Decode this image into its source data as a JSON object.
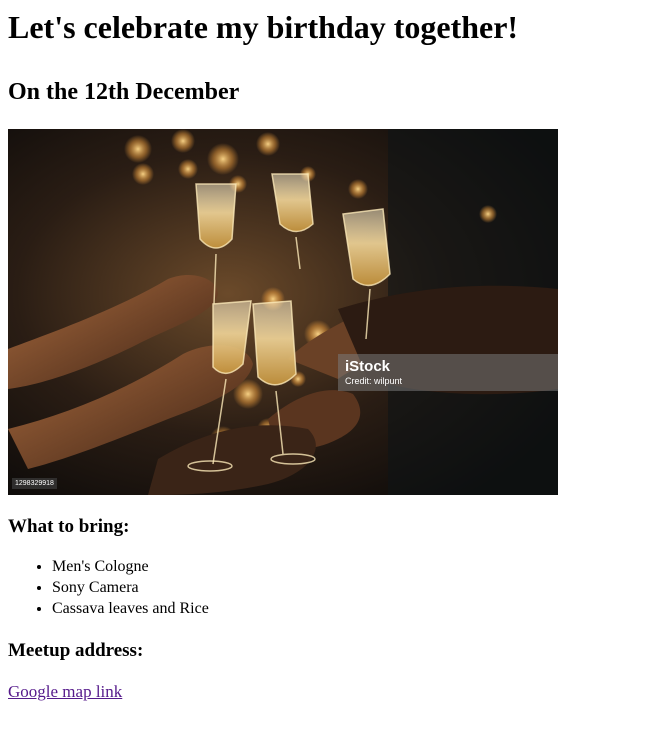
{
  "page": {
    "title": "Let's celebrate my birthday together!",
    "date_heading": "On the 12th December"
  },
  "photo": {
    "description_icon": "champagne-toast-photo",
    "watermark_logo": "iStock",
    "watermark_credit": "Credit: wilpunt",
    "image_id": "1298329918"
  },
  "bring": {
    "heading": "What to bring:",
    "items": [
      "Men's Cologne",
      "Sony Camera",
      "Cassava leaves and Rice"
    ]
  },
  "meetup": {
    "heading": "Meetup address:",
    "link_text": "Google map link"
  },
  "colors": {
    "link": "#551a8b",
    "text": "#000000",
    "background": "#ffffff"
  }
}
